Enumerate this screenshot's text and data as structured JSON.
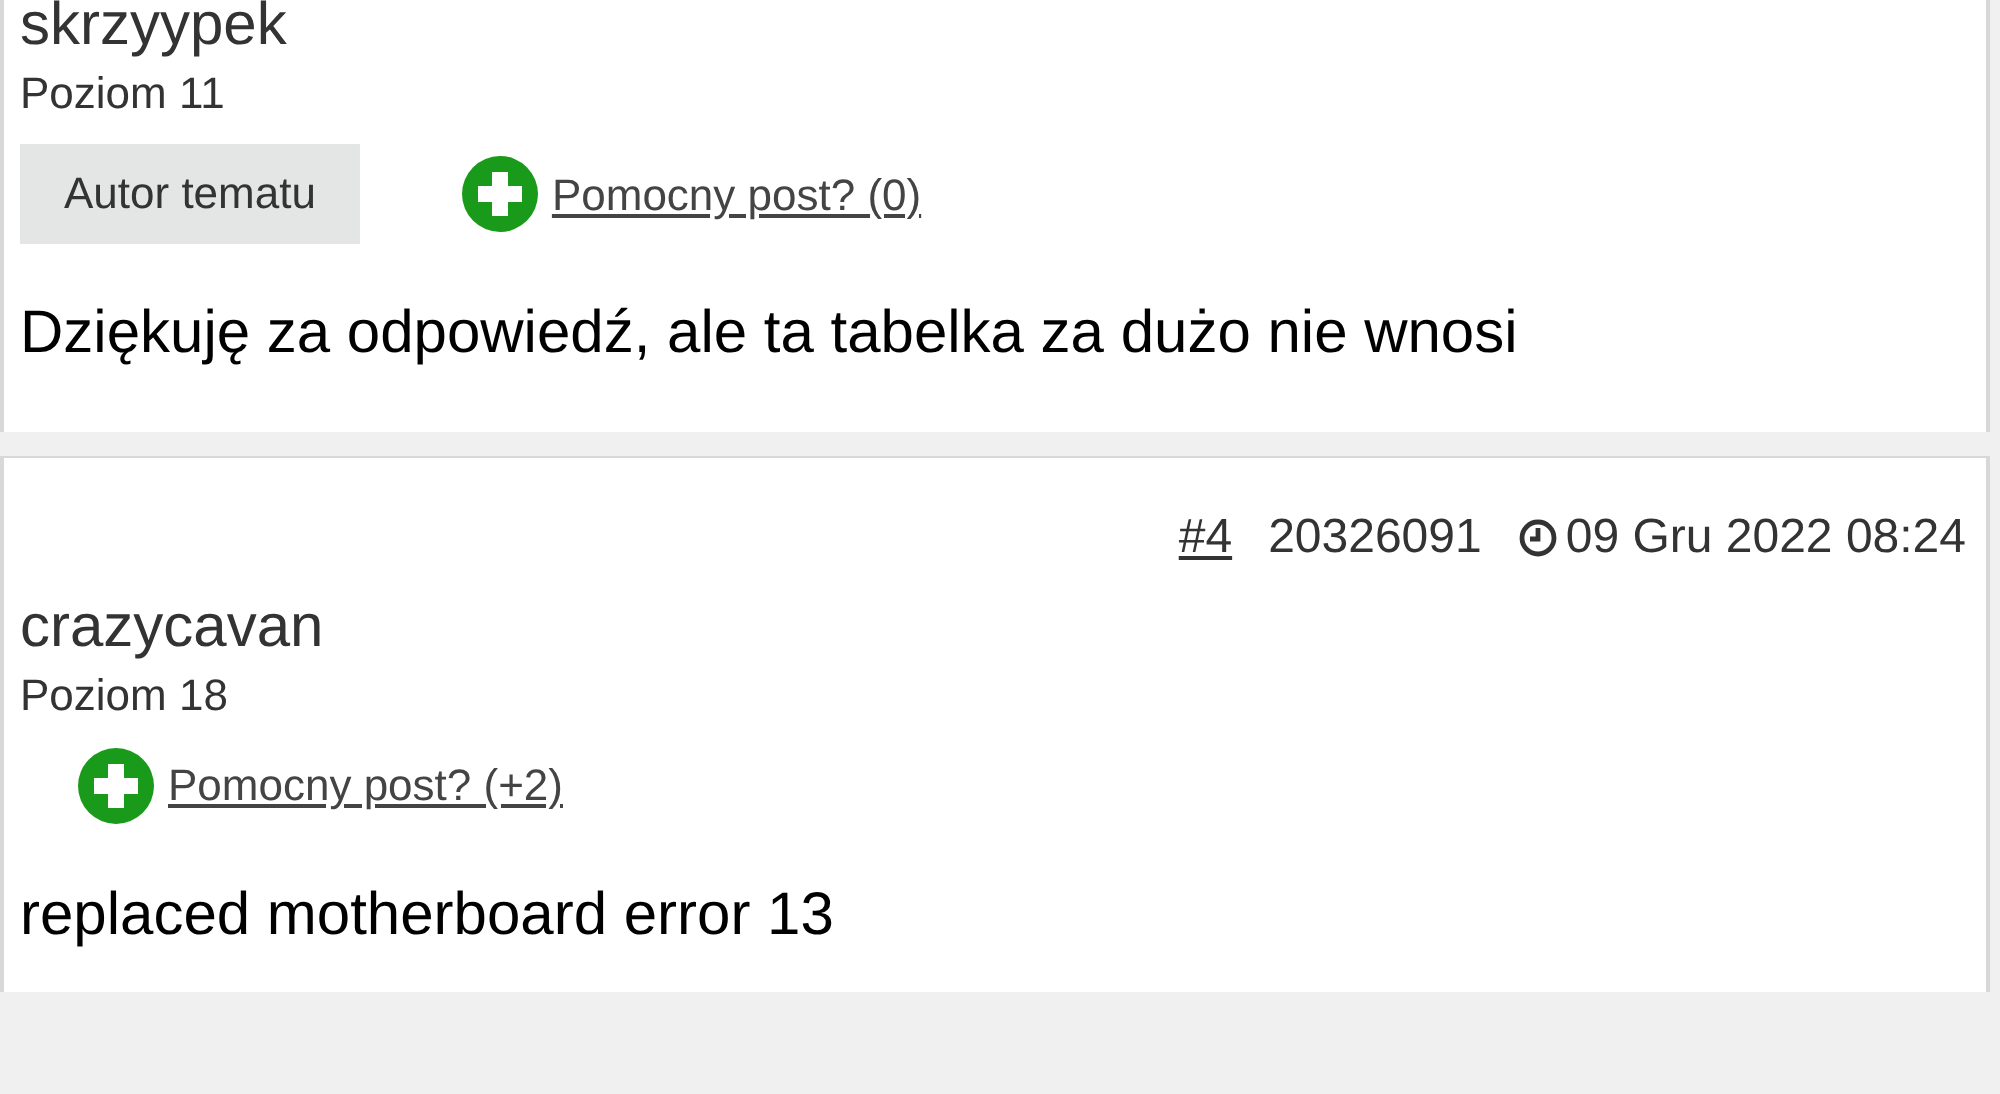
{
  "posts": [
    {
      "author": "skrzyypek",
      "rank": "Poziom 11",
      "badge": "Autor tematu",
      "helpful": "Pomocny post? (0)",
      "body": "Dziękuję za odpowiedź, ale ta tabelka za dużo nie wnosi"
    },
    {
      "number": "#4",
      "post_id": "20326091",
      "date": "09 Gru 2022 08:24",
      "author": "crazycavan",
      "rank": "Poziom 18",
      "helpful": "Pomocny post? (+2)",
      "body": "replaced motherboard error 13"
    }
  ]
}
